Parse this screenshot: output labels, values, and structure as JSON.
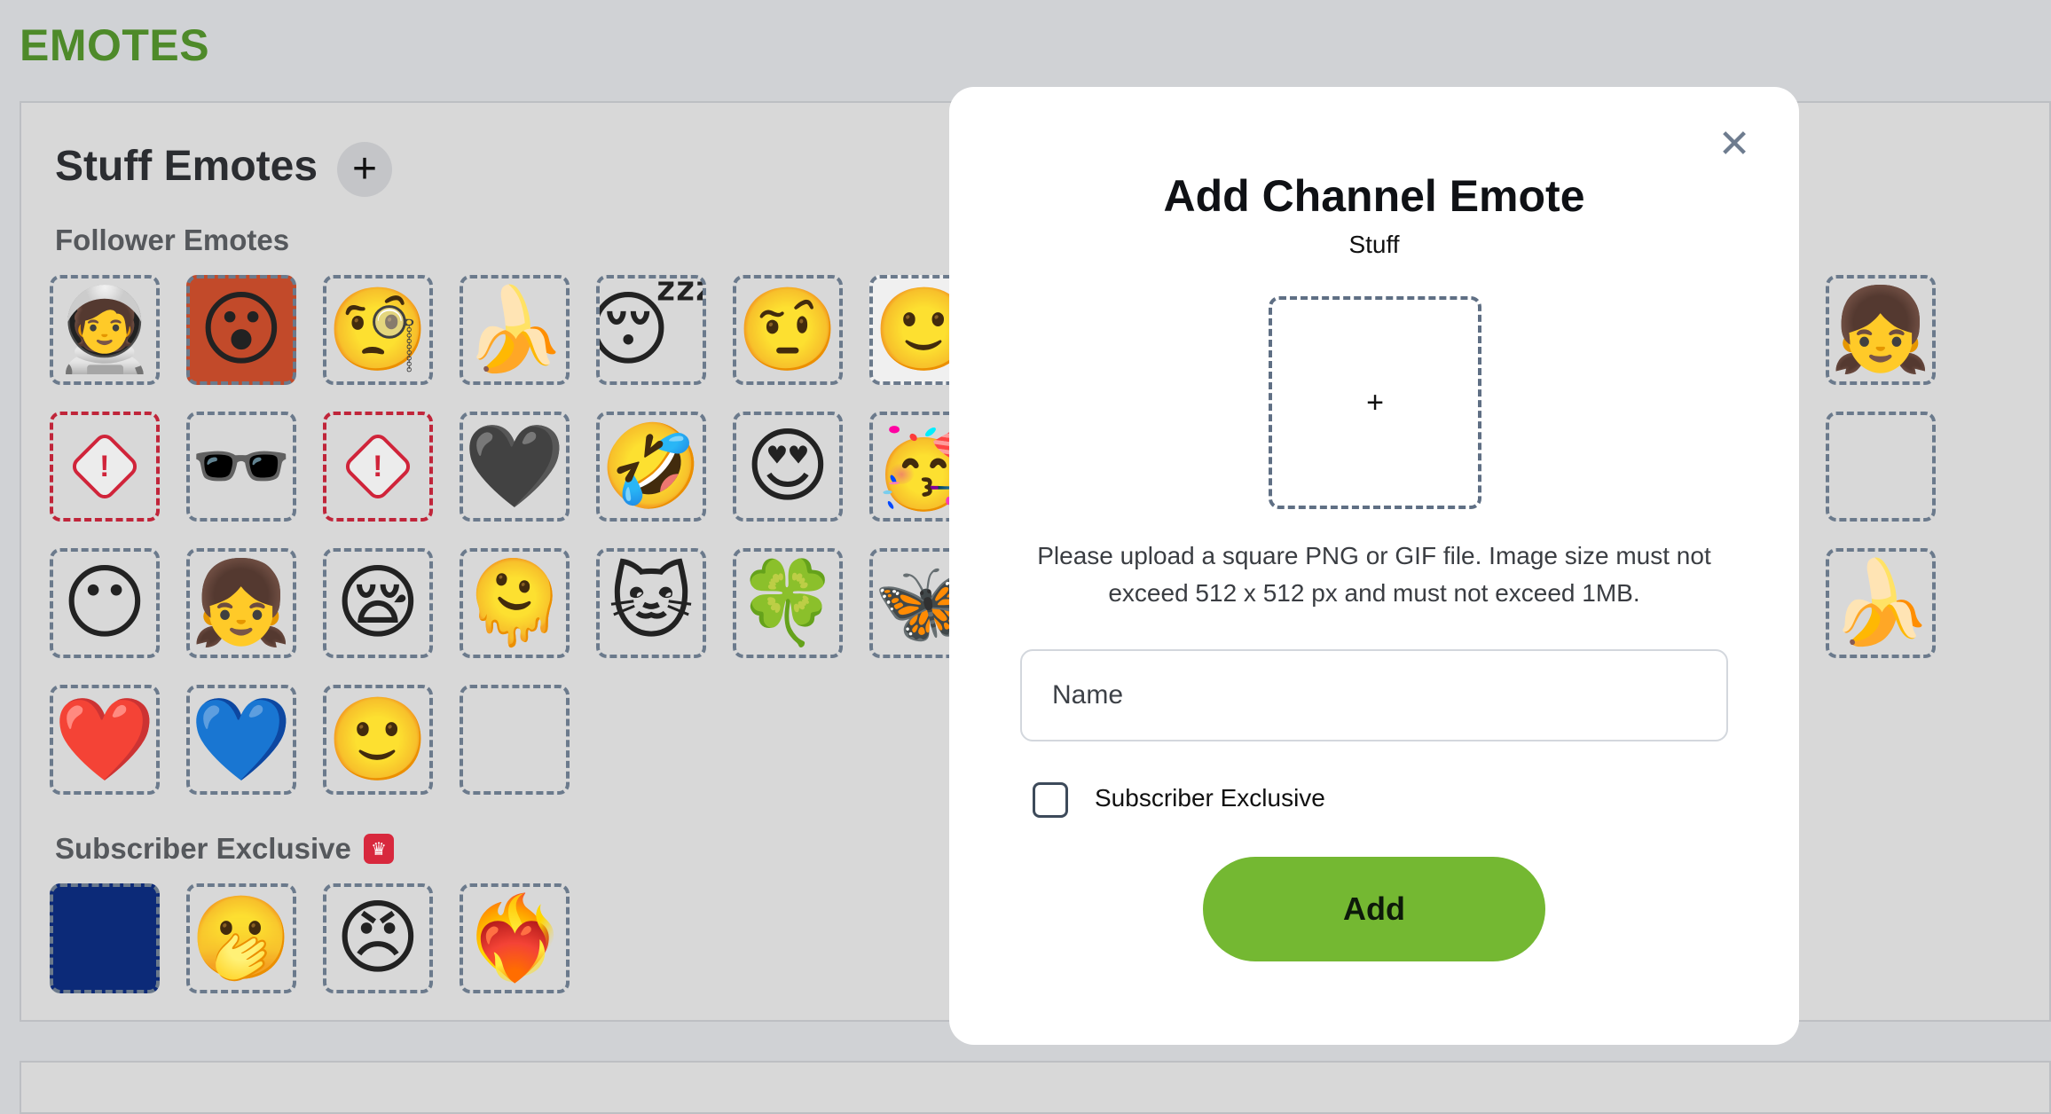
{
  "page": {
    "title": "EMOTES"
  },
  "section": {
    "title": "Stuff Emotes",
    "add_symbol": "+",
    "follower_heading": "Follower Emotes",
    "subscriber_heading": "Subscriber Exclusive",
    "subscriber_badge_icon": "crown-icon"
  },
  "follower_tiles": [
    {
      "glyph": "🧑‍🚀",
      "state": "normal",
      "name": "astronaut-emote"
    },
    {
      "glyph": "😮",
      "state": "photo",
      "name": "face-photo-emote"
    },
    {
      "glyph": "🧐",
      "state": "normal",
      "name": "question-face-emote"
    },
    {
      "glyph": "🍌",
      "state": "normal",
      "name": "banana-gun-emote"
    },
    {
      "glyph": "😴",
      "state": "normal",
      "name": "sleeping-banana-emote"
    },
    {
      "glyph": "🤨",
      "state": "normal",
      "name": "raised-eyebrow-emote"
    },
    {
      "glyph": "🙂",
      "state": "photo2",
      "name": "man-photo-emote"
    },
    {
      "glyph": "👧",
      "state": "normal",
      "name": "girl-emote"
    },
    {
      "glyph": "",
      "state": "blocked",
      "name": "blocked-emote-1"
    },
    {
      "glyph": "🕶️",
      "state": "normal",
      "name": "sunglasses-girl-emote"
    },
    {
      "glyph": "",
      "state": "blocked",
      "name": "blocked-emote-2"
    },
    {
      "glyph": "🖤",
      "state": "normal",
      "name": "black-heart-emote"
    },
    {
      "glyph": "🤣",
      "state": "normal",
      "name": "rofl-emote"
    },
    {
      "glyph": "😍",
      "state": "normal",
      "name": "heart-eyes-emote"
    },
    {
      "glyph": "🥳",
      "state": "normal",
      "name": "party-emote"
    },
    {
      "glyph": "",
      "state": "empty",
      "name": "empty-emote-1"
    },
    {
      "glyph": "😶",
      "state": "normal",
      "name": "no-mouth-emote"
    },
    {
      "glyph": "👧",
      "state": "normal",
      "name": "girl-thinking-emote"
    },
    {
      "glyph": "😪",
      "state": "normal",
      "name": "sleepy-emote"
    },
    {
      "glyph": "🫠",
      "state": "normal",
      "name": "melting-emote"
    },
    {
      "glyph": "🐱",
      "state": "normal",
      "name": "grey-cat-emote"
    },
    {
      "glyph": "🍀",
      "state": "normal",
      "name": "clover-emote"
    },
    {
      "glyph": "🦋",
      "state": "normal",
      "name": "butterfly-emote"
    },
    {
      "glyph": "🍌",
      "state": "normal",
      "name": "dancing-banana-emote"
    },
    {
      "glyph": "❤️",
      "state": "normal",
      "name": "red-heart-emote"
    },
    {
      "glyph": "💙",
      "state": "normal",
      "name": "blue-heart-emote"
    },
    {
      "glyph": "🙂",
      "state": "normal",
      "name": "smile-emote"
    },
    {
      "glyph": "",
      "state": "empty",
      "name": "empty-emote-2"
    }
  ],
  "subscriber_tiles": [
    {
      "glyph": "",
      "state": "dark",
      "name": "dark-blue-emote"
    },
    {
      "glyph": "🫢",
      "state": "normal",
      "name": "shy-emote"
    },
    {
      "glyph": "😠",
      "state": "normal",
      "name": "angry-emote"
    },
    {
      "glyph": "❤️‍🔥",
      "state": "normal",
      "name": "heart-fire-emote"
    }
  ],
  "modal": {
    "title": "Add Channel Emote",
    "subtitle": "Stuff",
    "close_icon": "close-icon",
    "upload_symbol": "+",
    "help_text": "Please upload a square PNG or GIF file. Image size must not exceed 512 x 512 px and must not exceed 1MB.",
    "name_placeholder": "Name",
    "name_value": "",
    "checkbox_label": "Subscriber Exclusive",
    "checkbox_checked": false,
    "add_label": "Add"
  },
  "colors": {
    "brand_green": "#74b832",
    "title_green": "#4e8a2a",
    "tile_border": "#6b7a8c",
    "blocked_border": "#c0253a",
    "badge_red": "#d8283d"
  }
}
